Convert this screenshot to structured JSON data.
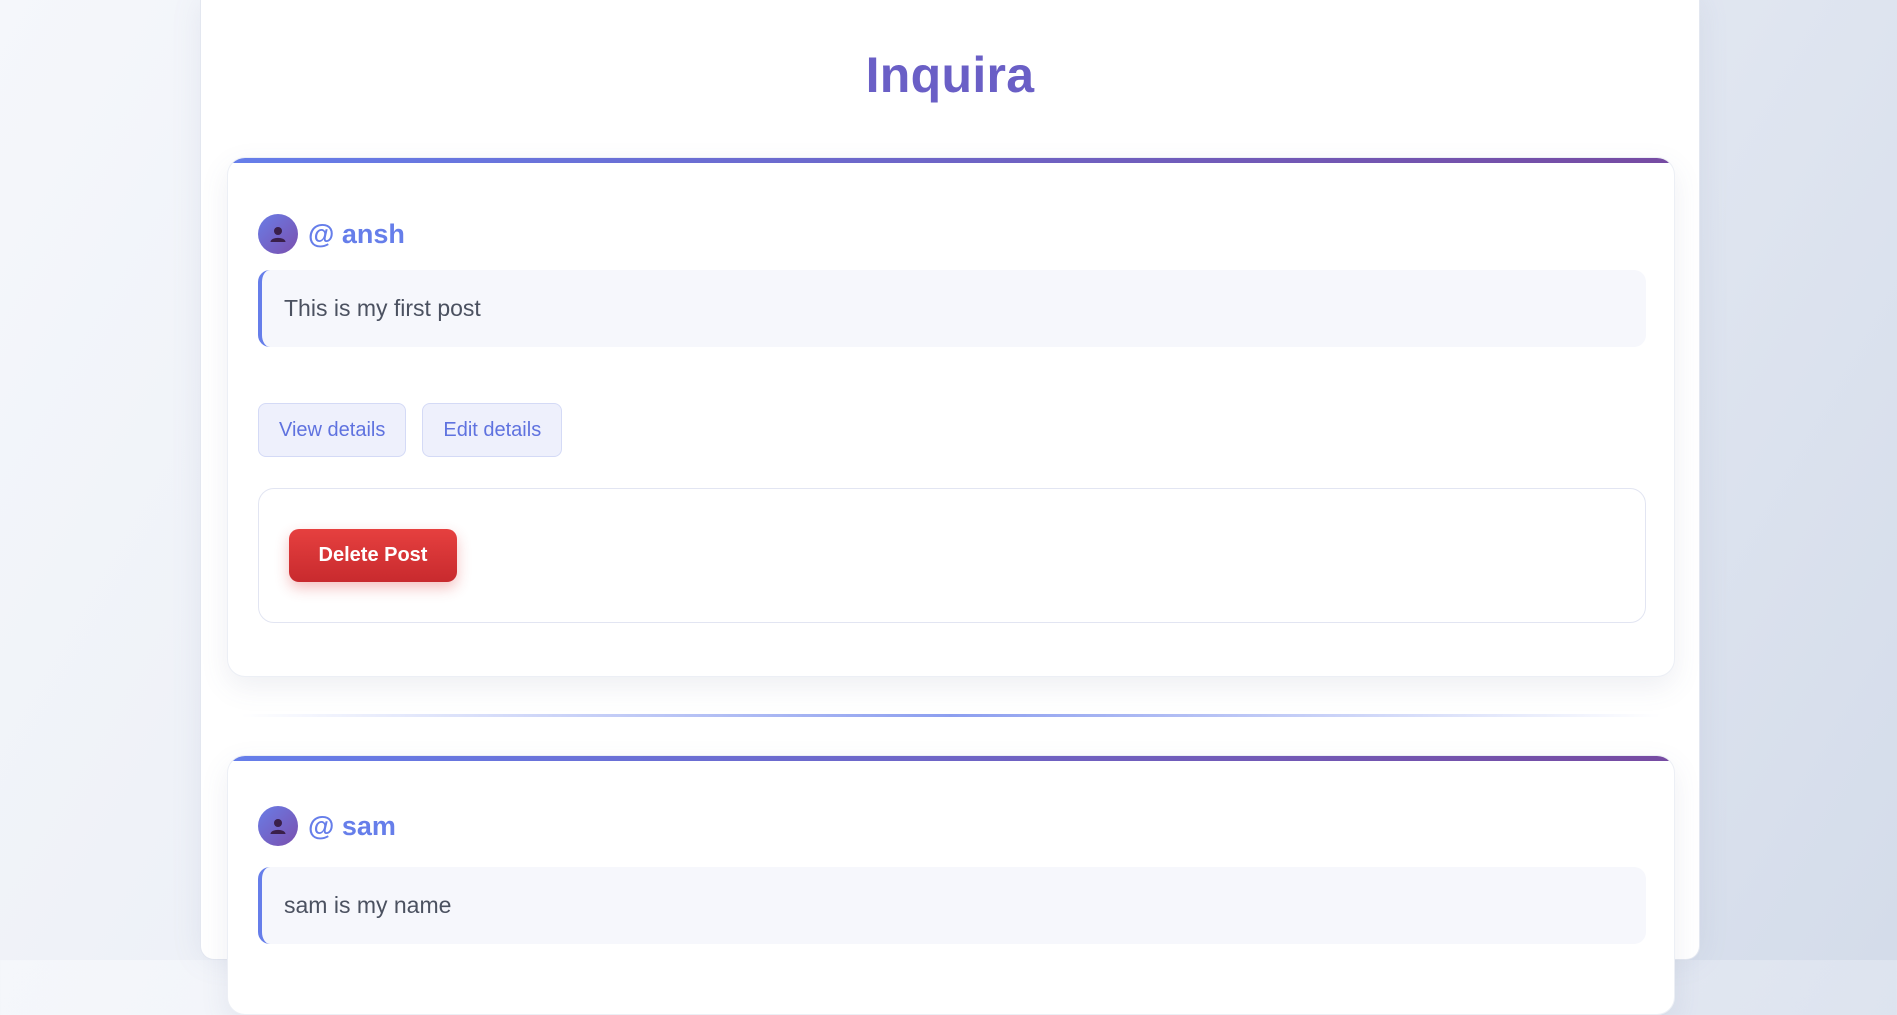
{
  "app": {
    "title": "Inquira"
  },
  "colors": {
    "accent": "#667eea",
    "accent_end": "#764ba2",
    "title": "#6a5fc6",
    "danger": "#dc3545"
  },
  "posts": [
    {
      "author_prefix": "@",
      "username": "ansh",
      "avatar_icon": "user-icon",
      "content": "This is my first post",
      "view_label": "View details",
      "edit_label": "Edit details",
      "delete_label": "Delete Post"
    },
    {
      "author_prefix": "@",
      "username": "sam",
      "avatar_icon": "user-icon",
      "content": "sam is my name"
    }
  ]
}
